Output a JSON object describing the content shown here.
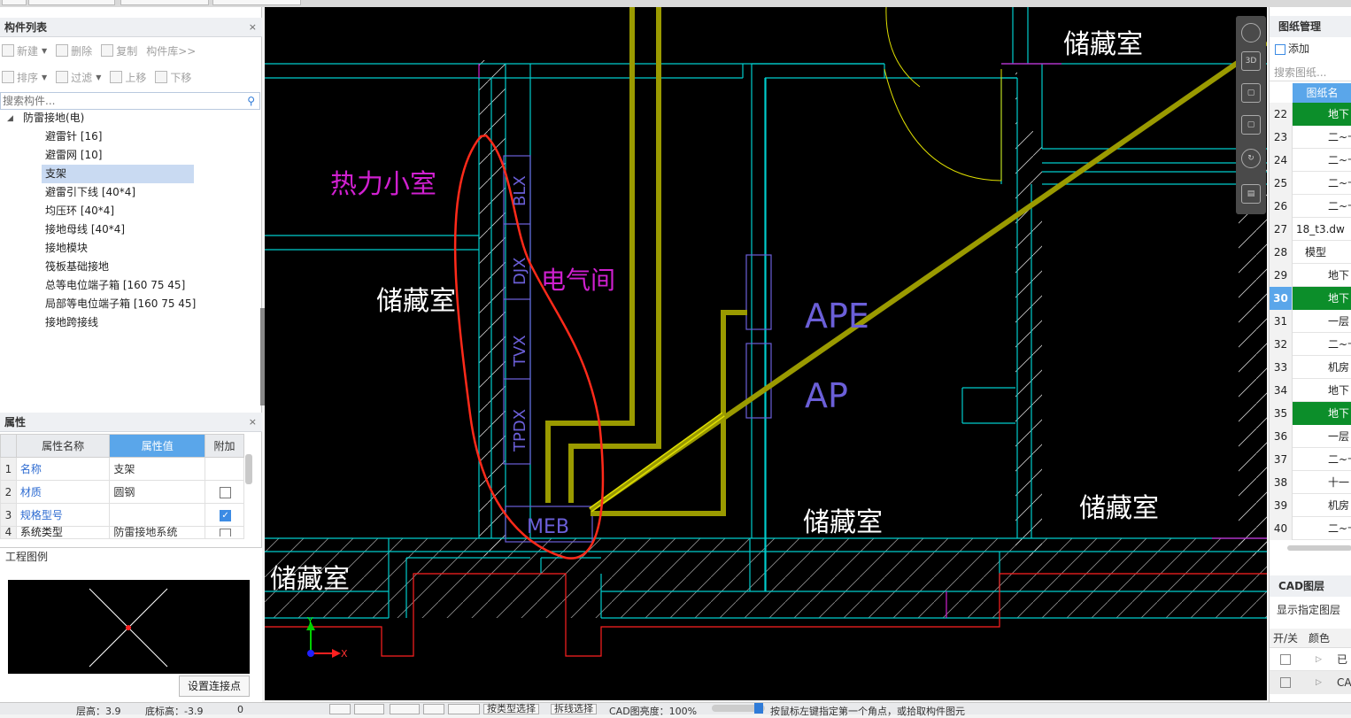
{
  "left": {
    "component_list": {
      "title": "构件列表",
      "close": "×",
      "toolbar1": {
        "new": "新建",
        "delete": "删除",
        "copy": "复制",
        "library": "构件库>>"
      },
      "toolbar2": {
        "sort": "排序",
        "filter": "过滤",
        "up": "上移",
        "down": "下移"
      },
      "search_placeholder": "搜索构件...",
      "root": "防雷接地(电)",
      "items": [
        "避雷针 [16]",
        "避雷网 [10]",
        "支架",
        "避雷引下线 [40*4]",
        "均压环 [40*4]",
        "接地母线 [40*4]",
        "接地模块",
        "筏板基础接地",
        "总等电位端子箱 [160 75 45]",
        "局部等电位端子箱 [160 75 45]",
        "接地跨接线"
      ],
      "selected_index": 2
    },
    "properties": {
      "title": "属性",
      "close": "×",
      "headers": [
        "属性名称",
        "属性值",
        "附加"
      ],
      "rows": [
        {
          "num": "1",
          "name": "名称",
          "value": "支架",
          "checkbox": "none"
        },
        {
          "num": "2",
          "name": "材质",
          "value": "圆钢",
          "checkbox": "off"
        },
        {
          "num": "3",
          "name": "规格型号",
          "value": "",
          "checkbox": "on"
        },
        {
          "num": "4",
          "name": "系统类型",
          "value": "防雷接地系统",
          "checkbox": "off"
        }
      ]
    },
    "legend": {
      "title": "工程图例",
      "connect_button": "设置连接点"
    }
  },
  "canvas": {
    "labels": {
      "storage1": "储藏室",
      "storage2": "储藏室",
      "storage3": "储藏室",
      "storage4": "储藏室",
      "storage5": "储藏室",
      "heat_room": "热力小室",
      "electric_room": "电气间",
      "ape": "APE",
      "ap": "AP",
      "meb": "MEB",
      "blx": "BLX",
      "djx": "DJX",
      "tvx": "TVX",
      "tpdx": "TPDX",
      "axis_x": "X",
      "axis_y": "Y"
    },
    "nav": {
      "view3d": "3D"
    },
    "colors": {
      "wall": "#00cccc",
      "bar": "#9a9a00",
      "highlight": "#e0e000",
      "annotation": "#ff2a1a",
      "magenta": "#d020d0",
      "purple": "#6b5fd8"
    }
  },
  "right": {
    "drawing_mgmt": {
      "title": "图纸管理",
      "add": "添加",
      "search_placeholder": "搜索图纸...",
      "col_header": "图纸名",
      "rows": [
        {
          "num": "22",
          "text": "地下",
          "green": true
        },
        {
          "num": "23",
          "text": "二~十",
          "green": false
        },
        {
          "num": "24",
          "text": "二~十",
          "green": false
        },
        {
          "num": "25",
          "text": "二~十",
          "green": false
        },
        {
          "num": "26",
          "text": "二~十",
          "green": false
        },
        {
          "num": "27",
          "text": "18_t3.dw",
          "green": false
        },
        {
          "num": "28",
          "text": "模型",
          "green": false
        },
        {
          "num": "29",
          "text": "地下",
          "green": false
        },
        {
          "num": "30",
          "text": "地下",
          "green": true,
          "active": true
        },
        {
          "num": "31",
          "text": "一层",
          "green": false
        },
        {
          "num": "32",
          "text": "二~十",
          "green": false
        },
        {
          "num": "33",
          "text": "机房",
          "green": false
        },
        {
          "num": "34",
          "text": "地下",
          "green": false
        },
        {
          "num": "35",
          "text": "地下",
          "green": true
        },
        {
          "num": "36",
          "text": "一层",
          "green": false
        },
        {
          "num": "37",
          "text": "二~十",
          "green": false
        },
        {
          "num": "38",
          "text": "十一",
          "green": false
        },
        {
          "num": "39",
          "text": "机房",
          "green": false
        },
        {
          "num": "40",
          "text": "二~十",
          "green": false
        }
      ]
    },
    "cad_layer": {
      "title": "CAD图层",
      "show_specified": "显示指定图层",
      "col_onoff": "开/关",
      "col_color": "颜色",
      "row1": "已",
      "row2": "CA"
    }
  },
  "status": {
    "floor_height": "层高：3.9",
    "bottom_elev": "底标高：-3.9",
    "zero": "0",
    "btn1": "按类型选择",
    "btn2": "拆线选择",
    "cad_brightness": "CAD图亮度：100%",
    "hint": "按鼠标左键指定第一个角点，或拾取构件图元"
  }
}
